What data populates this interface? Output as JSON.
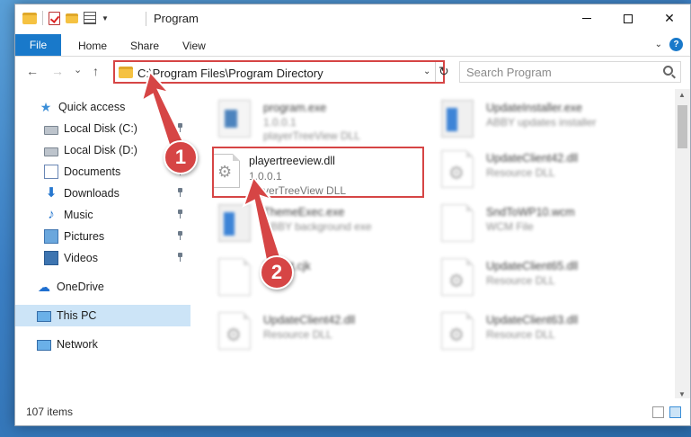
{
  "window": {
    "title": "Program",
    "controls": {
      "minimize": "",
      "maximize": "",
      "close": "✕"
    }
  },
  "ribbon": {
    "tabs": [
      {
        "label": "File"
      },
      {
        "label": "Home"
      },
      {
        "label": "Share"
      },
      {
        "label": "View"
      }
    ],
    "help": "?"
  },
  "navigation": {
    "back": "←",
    "forward": "→",
    "recent": "⌄",
    "up": "↑",
    "address": "C:\\Program Files\\Program Directory",
    "refresh": "↻"
  },
  "search": {
    "placeholder": "Search Program"
  },
  "sidebar": {
    "items": [
      {
        "label": "Quick access",
        "icon": "star-icon"
      },
      {
        "label": "Local Disk (C:)",
        "icon": "drive-icon",
        "pinned": true
      },
      {
        "label": "Local Disk (D:)",
        "icon": "drive-icon",
        "pinned": false
      },
      {
        "label": "Documents",
        "icon": "documents-icon",
        "pinned": true
      },
      {
        "label": "Downloads",
        "icon": "downloads-icon",
        "pinned": true
      },
      {
        "label": "Music",
        "icon": "music-icon",
        "pinned": true
      },
      {
        "label": "Pictures",
        "icon": "pictures-icon",
        "pinned": true
      },
      {
        "label": "Videos",
        "icon": "videos-icon",
        "pinned": true
      },
      {
        "label": "OneDrive",
        "icon": "onedrive-icon"
      },
      {
        "label": "This PC",
        "icon": "this-pc-icon",
        "selected": true
      },
      {
        "label": "Network",
        "icon": "network-icon"
      }
    ]
  },
  "files": {
    "highlighted": {
      "name": "playertreeview.dll",
      "version": "1.0.0.1",
      "description": "playerTreeView DLL",
      "icon": "dll-gear-icon"
    },
    "background": [
      {
        "name": "program.exe",
        "line2": "1.0.0.1",
        "line3": "playerTreeView DLL"
      },
      {
        "name": "UpdateInstaller.exe",
        "line2": "ABBY updates installer",
        "line3": ""
      },
      {
        "name": "UpdateClient42.dll",
        "line2": "Resource DLL",
        "line3": ""
      },
      {
        "name": "ThemeExec.exe",
        "line2": "ABBY background exe",
        "line3": ""
      },
      {
        "name": "SndToWP10.wcm",
        "line2": "WCM File",
        "line3": ""
      },
      {
        "name": "fontlnt.cjk",
        "line2": "",
        "line3": ""
      },
      {
        "name": "UpdateClient65.dll",
        "line2": "Resource DLL",
        "line3": ""
      },
      {
        "name": "UpdateClient42.dll",
        "line2": "Resource DLL",
        "line3": ""
      },
      {
        "name": "UpdateClient63.dll",
        "line2": "Resource DLL",
        "line3": ""
      }
    ]
  },
  "status": {
    "item_count": "107 items"
  },
  "annotations": {
    "step1": "1",
    "step2": "2"
  },
  "colors": {
    "accent": "#1979ca",
    "highlight_red": "#d64545",
    "selection": "#cce4f7"
  }
}
